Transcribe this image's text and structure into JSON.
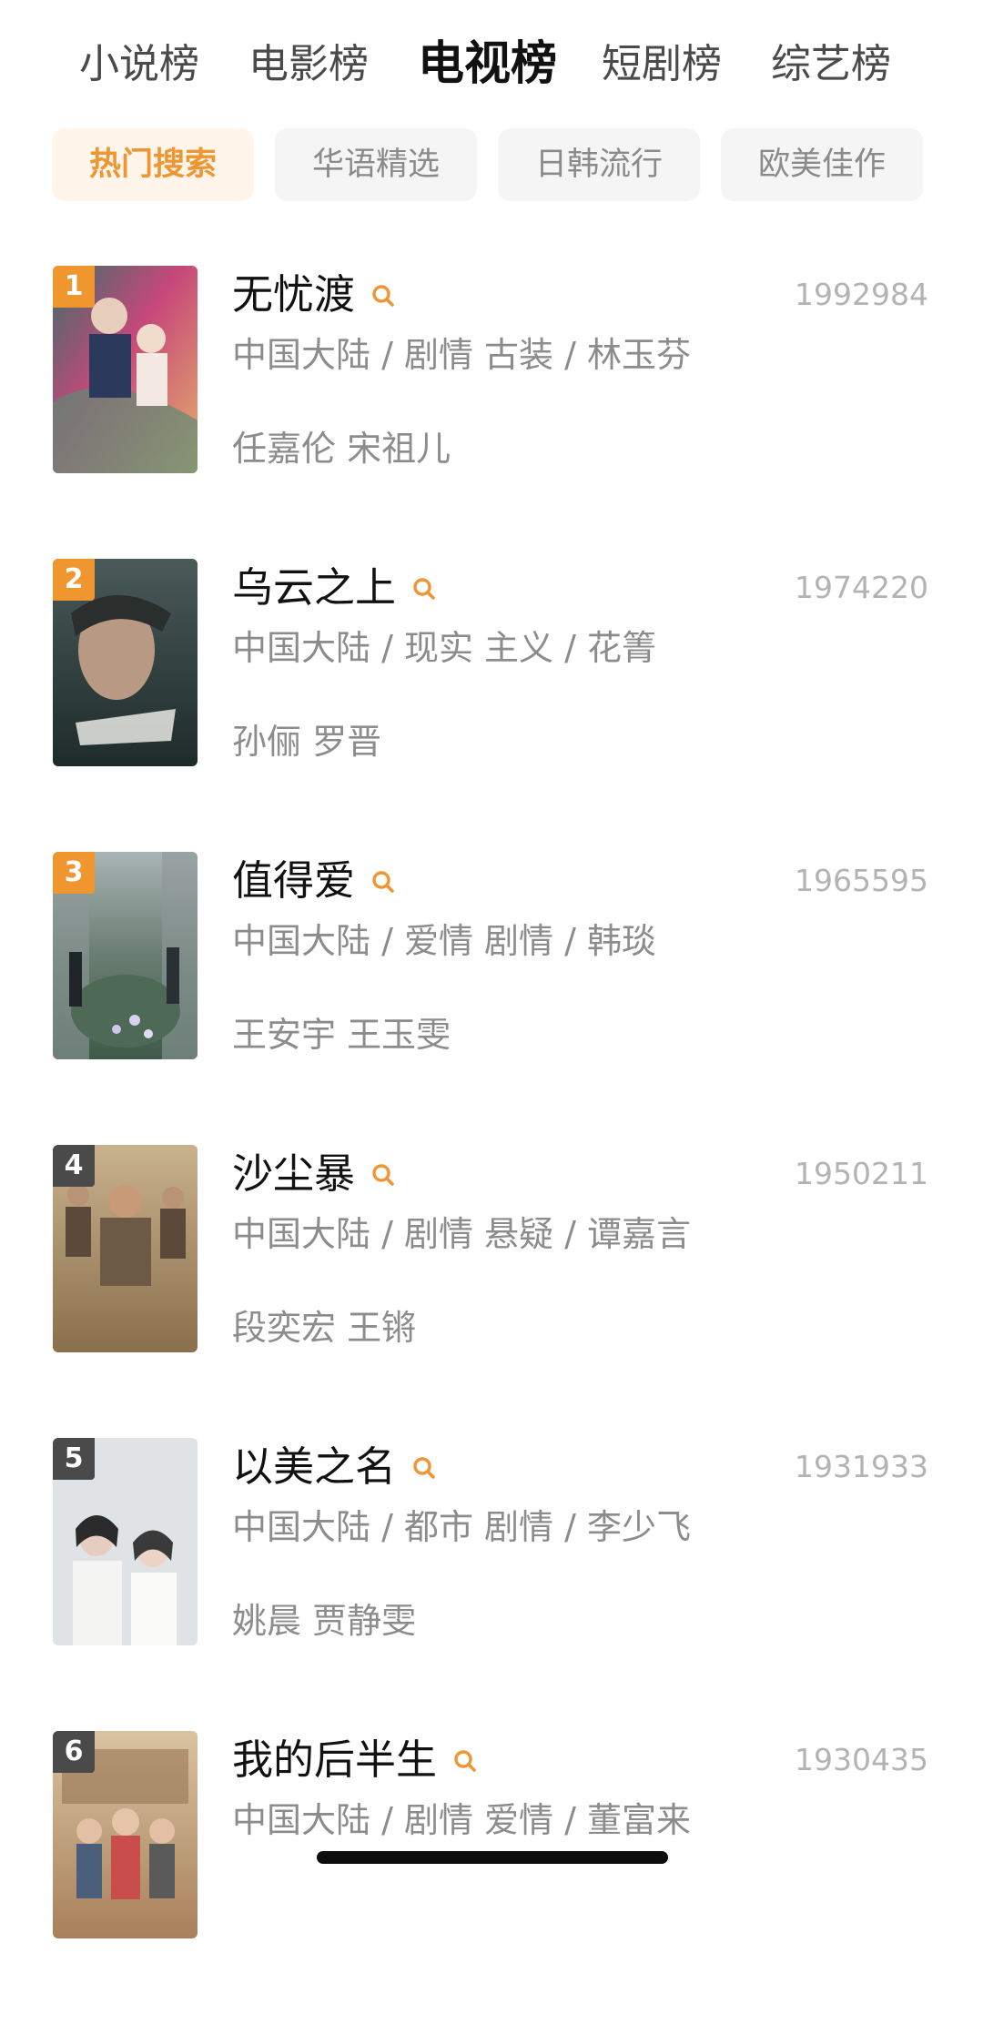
{
  "category_tabs": [
    {
      "label": "小说榜",
      "active": false
    },
    {
      "label": "电影榜",
      "active": false
    },
    {
      "label": "电视榜",
      "active": true
    },
    {
      "label": "短剧榜",
      "active": false
    },
    {
      "label": "综艺榜",
      "active": false
    }
  ],
  "filter_chips": [
    {
      "label": "热门搜索",
      "active": true
    },
    {
      "label": "华语精选",
      "active": false
    },
    {
      "label": "日韩流行",
      "active": false
    },
    {
      "label": "欧美佳作",
      "active": false
    }
  ],
  "colors": {
    "accent": "#ef9633",
    "rank_top": "#f0962f",
    "rank_other": "#4a4a4a"
  },
  "items": [
    {
      "rank": "1",
      "title": "无忧渡",
      "score": "1992984",
      "meta": "中国大陆 / 剧情 古装 / 林玉芬",
      "cast": "任嘉伦 宋祖儿",
      "search_icon": "search-icon"
    },
    {
      "rank": "2",
      "title": "乌云之上",
      "score": "1974220",
      "meta": "中国大陆 / 现实 主义 / 花箐",
      "cast": "孙俪 罗晋",
      "search_icon": "search-icon"
    },
    {
      "rank": "3",
      "title": "值得爱",
      "score": "1965595",
      "meta": "中国大陆 / 爱情 剧情 / 韩琰",
      "cast": "王安宇 王玉雯",
      "search_icon": "search-icon"
    },
    {
      "rank": "4",
      "title": "沙尘暴",
      "score": "1950211",
      "meta": "中国大陆 / 剧情 悬疑 / 谭嘉言",
      "cast": "段奕宏 王锵",
      "search_icon": "search-icon"
    },
    {
      "rank": "5",
      "title": "以美之名",
      "score": "1931933",
      "meta": "中国大陆 / 都市 剧情 / 李少飞",
      "cast": "姚晨 贾静雯",
      "search_icon": "search-icon"
    },
    {
      "rank": "6",
      "title": "我的后半生",
      "score": "1930435",
      "meta": "中国大陆 / 剧情 爱情 / 董富来",
      "cast": "",
      "search_icon": "search-icon"
    }
  ]
}
